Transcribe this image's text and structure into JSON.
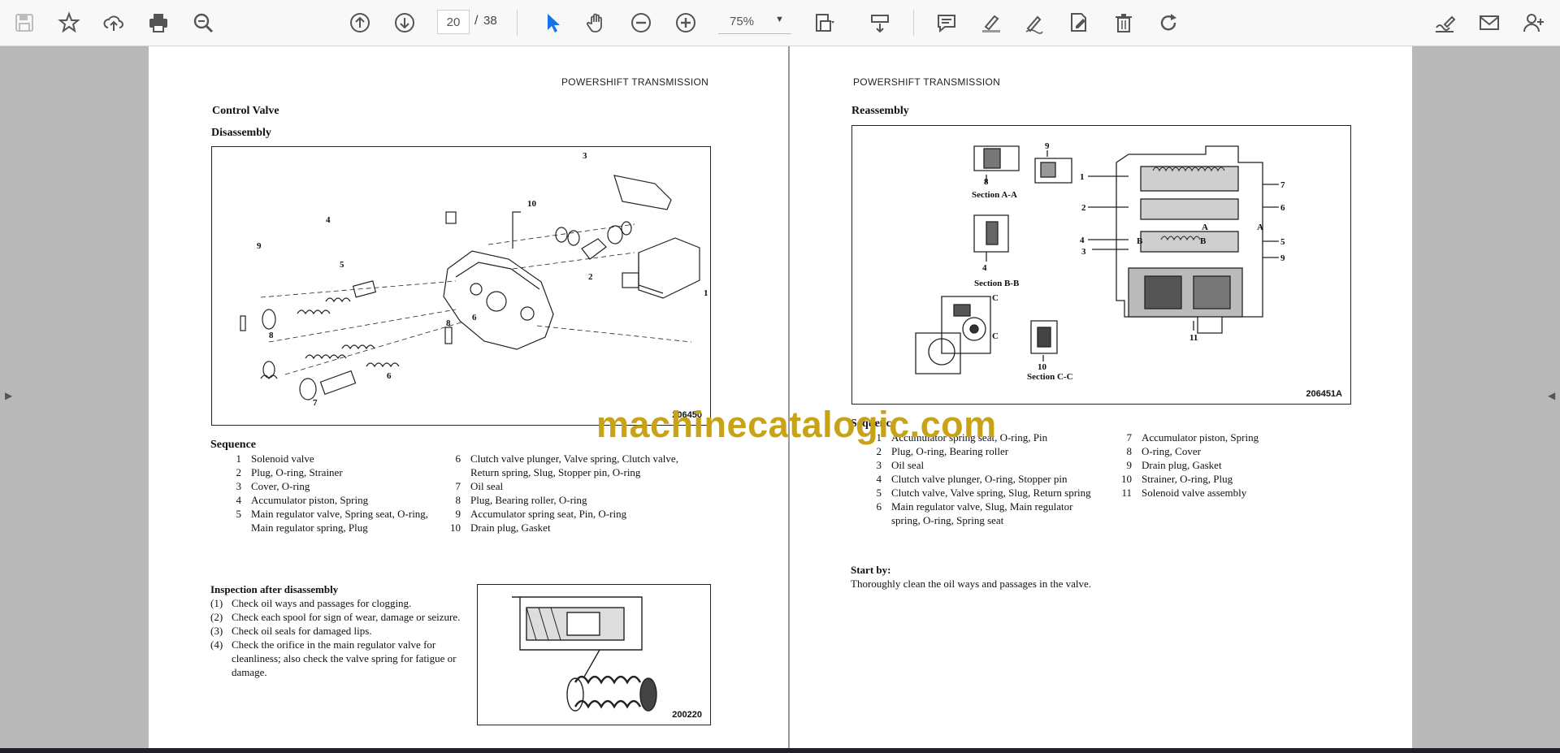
{
  "toolbar": {
    "page_current": "20",
    "page_separator": "/",
    "page_total": "38",
    "zoom": "75%",
    "icons": [
      "save-icon",
      "star-icon",
      "cloud-upload-icon",
      "print-icon",
      "zoom-search-icon",
      "arrow-up-icon",
      "arrow-down-icon",
      "cursor-icon",
      "hand-icon",
      "zoom-out-icon",
      "zoom-in-icon",
      "page-fit-icon",
      "scroll-mode-icon",
      "comment-icon",
      "highlight-icon",
      "draw-icon",
      "edit-pdf-icon",
      "delete-icon",
      "rotate-icon",
      "fill-sign-icon",
      "mail-icon",
      "add-user-icon"
    ],
    "accent": "#1473e6"
  },
  "left_page": {
    "header": "POWERSHIFT TRANSMISSION",
    "section": "Control Valve",
    "subsection": "Disassembly",
    "figure": {
      "code": "206450",
      "callouts": [
        "1",
        "2",
        "3",
        "4",
        "5",
        "6",
        "7",
        "8",
        "9",
        "10"
      ]
    },
    "sequence_title": "Sequence",
    "sequence_col1": [
      {
        "n": "1",
        "text": "Solenoid valve"
      },
      {
        "n": "2",
        "text": "Plug, O-ring, Strainer"
      },
      {
        "n": "3",
        "text": "Cover, O-ring"
      },
      {
        "n": "4",
        "text": "Accumulator piston, Spring"
      },
      {
        "n": "5",
        "text": "Main regulator valve, Spring seat, O-ring, Main regulator spring, Plug"
      }
    ],
    "sequence_col2": [
      {
        "n": "6",
        "text": "Clutch valve plunger, Valve spring, Clutch valve, Return spring, Slug, Stopper pin, O-ring"
      },
      {
        "n": "7",
        "text": "Oil seal"
      },
      {
        "n": "8",
        "text": "Plug, Bearing roller, O-ring"
      },
      {
        "n": "9",
        "text": "Accumulator spring seat, Pin, O-ring"
      },
      {
        "n": "10",
        "text": "Drain plug, Gasket"
      }
    ],
    "inspection_title": "Inspection after disassembly",
    "inspection": [
      {
        "n": "(1)",
        "text": "Check oil ways and passages for clogging."
      },
      {
        "n": "(2)",
        "text": "Check each spool for sign of wear, damage or seizure."
      },
      {
        "n": "(3)",
        "text": "Check oil seals for damaged lips."
      },
      {
        "n": "(4)",
        "text": "Check the orifice in the main regulator valve for cleanliness; also check the valve spring for fatigue or damage."
      }
    ],
    "small_figure_code": "200220"
  },
  "right_page": {
    "header": "POWERSHIFT TRANSMISSION",
    "section": "Reassembly",
    "figure": {
      "code": "206451A",
      "labels": {
        "a": "Section A-A",
        "b": "Section B-B",
        "c": "Section C-C"
      },
      "callouts": [
        "1",
        "2",
        "3",
        "4",
        "5",
        "6",
        "7",
        "8",
        "9",
        "10",
        "11",
        "A",
        "B",
        "C"
      ]
    },
    "sequence_title": "Sequence",
    "sequence_col1": [
      {
        "n": "1",
        "text": "Accumulator spring seat, O-ring, Pin"
      },
      {
        "n": "2",
        "text": "Plug, O-ring, Bearing roller"
      },
      {
        "n": "3",
        "text": "Oil seal"
      },
      {
        "n": "4",
        "text": "Clutch valve plunger, O-ring, Stopper pin"
      },
      {
        "n": "5",
        "text": "Clutch valve, Valve spring, Slug, Return spring"
      },
      {
        "n": "6",
        "text": "Main regulator valve, Slug, Main regulator spring, O-ring, Spring seat"
      }
    ],
    "sequence_col2": [
      {
        "n": "7",
        "text": "Accumulator piston, Spring"
      },
      {
        "n": "8",
        "text": "O-ring, Cover"
      },
      {
        "n": "9",
        "text": "Drain plug, Gasket"
      },
      {
        "n": "10",
        "text": "Strainer, O-ring, Plug"
      },
      {
        "n": "11",
        "text": "Solenoid valve assembly"
      }
    ],
    "start_title": "Start by:",
    "start_text": "Thoroughly clean the oil ways and passages in the valve."
  },
  "watermark": "machinecatalogic.com"
}
